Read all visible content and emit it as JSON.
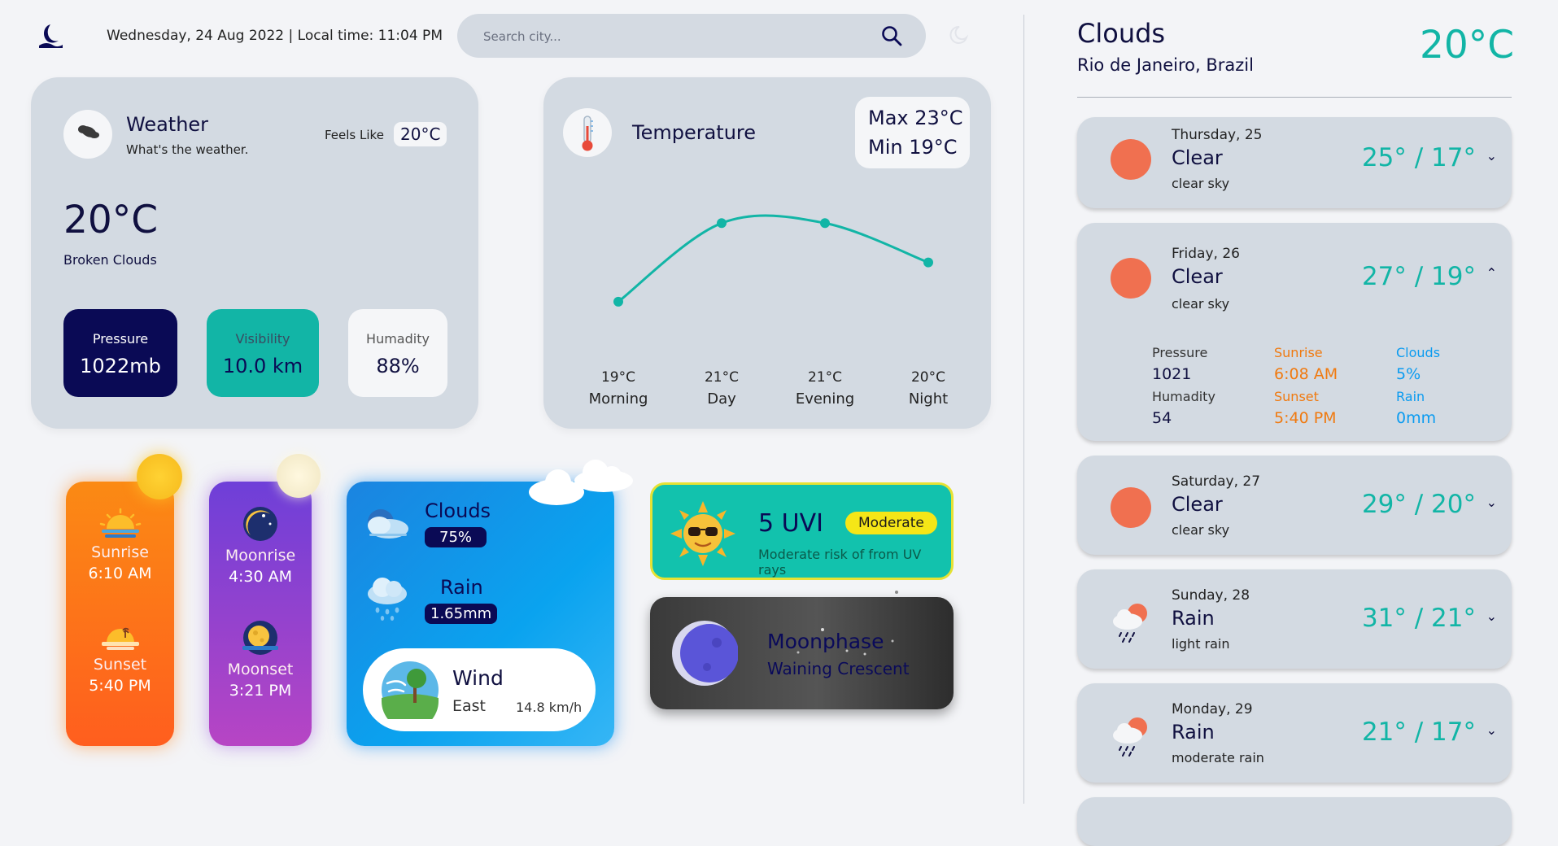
{
  "header": {
    "date_text": "Wednesday, 24 Aug 2022 | Local time: 11:04 PM",
    "search_placeholder": "Search city..."
  },
  "weather_card": {
    "title": "Weather",
    "subtitle": "What's the weather.",
    "feels_like_label": "Feels Like",
    "feels_like_value": "20°C",
    "temperature": "20°C",
    "description": "Broken Clouds",
    "pressure": {
      "label": "Pressure",
      "value": "1022mb"
    },
    "visibility": {
      "label": "Visibility",
      "value": "10.0 km"
    },
    "humidity": {
      "label": "Humadity",
      "value": "88%"
    }
  },
  "temperature_card": {
    "title": "Temperature",
    "max": "Max 23°C",
    "min": "Min 19°C"
  },
  "chart_data": {
    "type": "line",
    "categories": [
      "Morning",
      "Day",
      "Evening",
      "Night"
    ],
    "series": [
      {
        "values": [
          19,
          21,
          21,
          20
        ]
      }
    ],
    "labels": [
      "19°C",
      "21°C",
      "21°C",
      "20°C"
    ],
    "grid": false
  },
  "sun": {
    "sunrise_label": "Sunrise",
    "sunrise_time": "6:10 AM",
    "sunset_label": "Sunset",
    "sunset_time": "5:40 PM"
  },
  "moon": {
    "moonrise_label": "Moonrise",
    "moonrise_time": "4:30 AM",
    "moonset_label": "Moonset",
    "moonset_time": "3:21 PM"
  },
  "clouds_card": {
    "clouds_label": "Clouds",
    "clouds_value": "75%",
    "rain_label": "Rain",
    "rain_value": "1.65mm",
    "wind_label": "Wind",
    "wind_direction": "East",
    "wind_speed": "14.8 km/h"
  },
  "uv": {
    "value": "5 UVI",
    "level": "Moderate",
    "description": "Moderate risk of from UV rays"
  },
  "moonphase": {
    "title": "Moonphase",
    "phase": "Waining Crescent"
  },
  "current": {
    "condition": "Clouds",
    "location": "Rio de Janeiro, Brazil",
    "temperature": "20°C"
  },
  "forecast": [
    {
      "day": "Thursday, 25",
      "condition": "Clear",
      "description": "clear sky",
      "temps": "25° / 17°",
      "icon": "sun-icon",
      "chevron": "⌄"
    },
    {
      "day": "Friday, 26",
      "condition": "Clear",
      "description": "clear sky",
      "temps": "27° / 19°",
      "icon": "sun-icon",
      "chevron": "⌃",
      "details": {
        "pressure_label": "Pressure",
        "pressure": "1021",
        "humidity_label": "Humadity",
        "humidity": "54",
        "sunrise_label": "Sunrise",
        "sunrise": "6:08 AM",
        "sunset_label": "Sunset",
        "sunset": "5:40 PM",
        "clouds_label": "Clouds",
        "clouds": "5%",
        "rain_label": "Rain",
        "rain": "0mm"
      }
    },
    {
      "day": "Saturday, 27",
      "condition": "Clear",
      "description": "clear sky",
      "temps": "29° / 20°",
      "icon": "sun-icon",
      "chevron": "⌄"
    },
    {
      "day": "Sunday, 28",
      "condition": "Rain",
      "description": "light rain",
      "temps": "31° / 21°",
      "icon": "rain-cloud-icon",
      "chevron": "⌄"
    },
    {
      "day": "Monday, 29",
      "condition": "Rain",
      "description": "moderate rain",
      "temps": "21° / 17°",
      "icon": "rain-cloud-icon",
      "chevron": "⌄"
    }
  ],
  "colors": {
    "accent": "#12b5a6",
    "navy": "#0a0a55",
    "card": "#d3dae2",
    "sun_orange": "#f07050",
    "detail_orange": "#f07a10",
    "detail_blue": "#0a9bf0"
  }
}
